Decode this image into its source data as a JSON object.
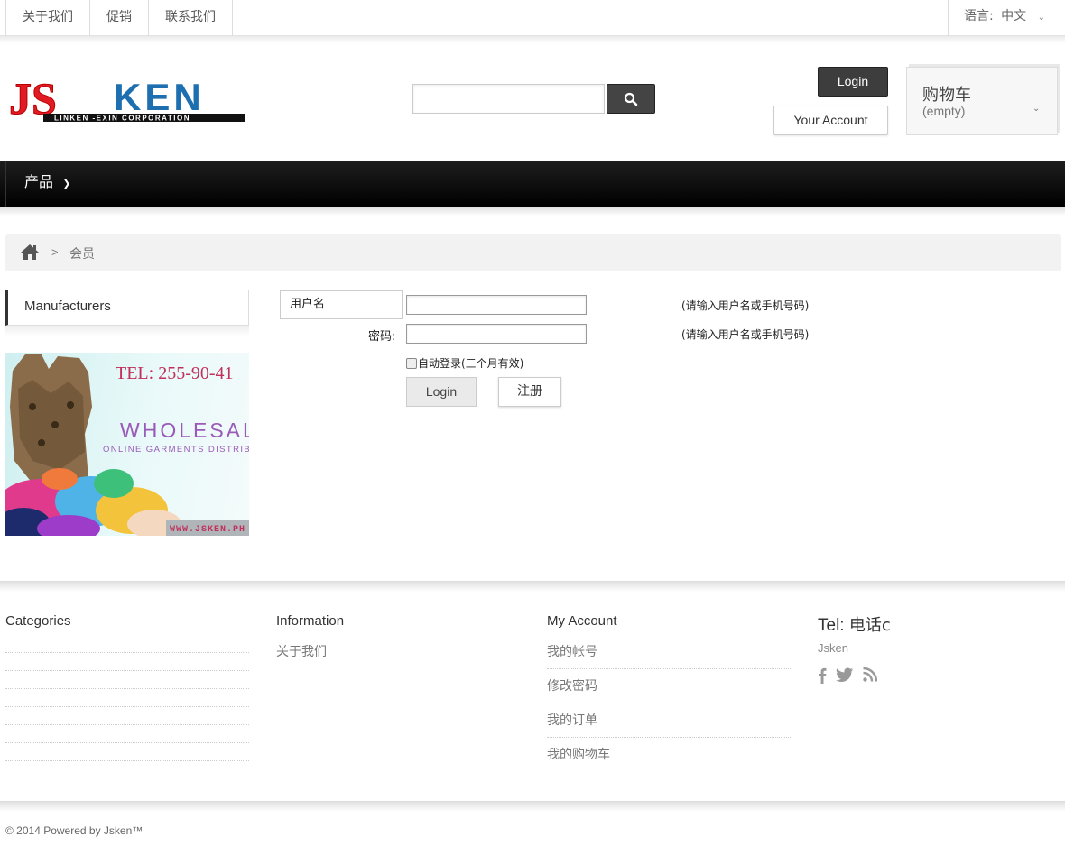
{
  "topbar": {
    "links": [
      "关于我们",
      "促销",
      "联系我们"
    ],
    "language_label": "语言:",
    "language_value": "中文"
  },
  "header": {
    "logo": {
      "brand_js": "JS",
      "brand_ken": "KEN",
      "tagline": "LINKEN -EXIN CORPORATION"
    },
    "search": {
      "placeholder": "",
      "button_icon": "search-icon"
    },
    "login_label": "Login",
    "account_label": "Your Account",
    "cart": {
      "title": "购物车",
      "status": "(empty)"
    }
  },
  "nav": {
    "items": [
      {
        "label": "产品"
      }
    ]
  },
  "breadcrumb": {
    "home_icon": "home-icon",
    "separator": ">",
    "current": "会员"
  },
  "sidebar": {
    "manufacturers_label": "Manufacturers",
    "banner": {
      "tel": "TEL: 255-90-41",
      "headline": "WHOLESALE",
      "subline": "ONLINE GARMENTS DISTRIBUTOR",
      "url": "WWW.JSKEN.PH"
    }
  },
  "login_form": {
    "username_label": "用户名",
    "username_value": "",
    "username_hint": "(请输入用户名或手机号码)",
    "password_label": "密码:",
    "password_value": "",
    "password_hint": "(请输入用户名或手机号码)",
    "remember_label": "自动登录(三个月有效)",
    "remember_checked": false,
    "login_button": "Login",
    "register_button": "注册"
  },
  "footer": {
    "categories_title": "Categories",
    "information_title": "Information",
    "information_links": [
      "关于我们"
    ],
    "account_title": "My Account",
    "account_links": [
      "我的帐号",
      "修改密码",
      "我的订单",
      "我的购物车"
    ],
    "tel_label": "Tel:",
    "tel_value": "电话c",
    "company": "Jsken",
    "social_icons": [
      "facebook-icon",
      "twitter-icon",
      "rss-icon"
    ],
    "copyright": "© 2014 Powered by Jsken™"
  }
}
